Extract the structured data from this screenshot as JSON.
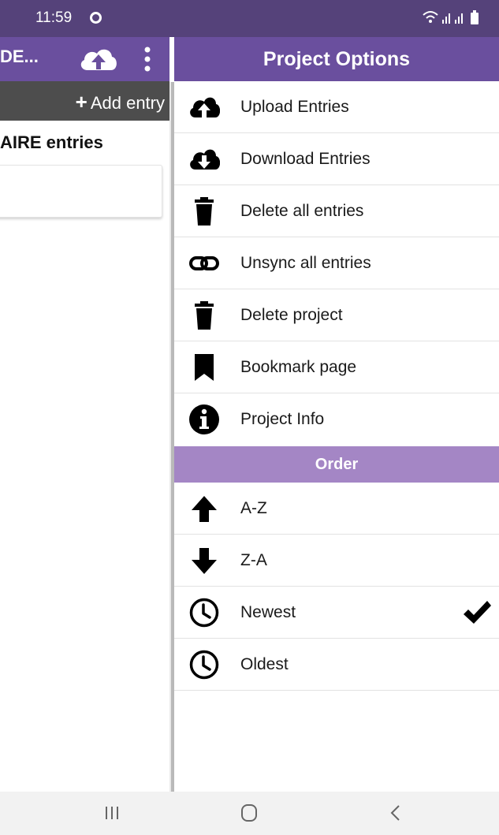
{
  "status_bar": {
    "time": "11:59"
  },
  "left_screen": {
    "title": "DE...",
    "add_entry": "Add entry",
    "heading": "AIRE entries"
  },
  "drawer": {
    "title": "Project Options",
    "items": [
      {
        "label": "Upload Entries",
        "icon": "cloud-upload-icon"
      },
      {
        "label": "Download Entries",
        "icon": "cloud-download-icon"
      },
      {
        "label": "Delete all entries",
        "icon": "trash-icon"
      },
      {
        "label": "Unsync all entries",
        "icon": "unlink-icon"
      },
      {
        "label": "Delete project",
        "icon": "trash-icon"
      },
      {
        "label": "Bookmark page",
        "icon": "bookmark-icon"
      },
      {
        "label": "Project Info",
        "icon": "info-icon"
      }
    ],
    "order_title": "Order",
    "order_items": [
      {
        "label": "A-Z",
        "icon": "arrow-up-icon"
      },
      {
        "label": "Z-A",
        "icon": "arrow-down-icon"
      },
      {
        "label": "Newest",
        "icon": "clock-icon",
        "selected": true
      },
      {
        "label": "Oldest",
        "icon": "clock-icon"
      }
    ]
  },
  "colors": {
    "status_bar": "#55427a",
    "app_bar": "#6a4f9e",
    "order_header": "#a486c5",
    "toolbar": "#4d4d4d"
  }
}
